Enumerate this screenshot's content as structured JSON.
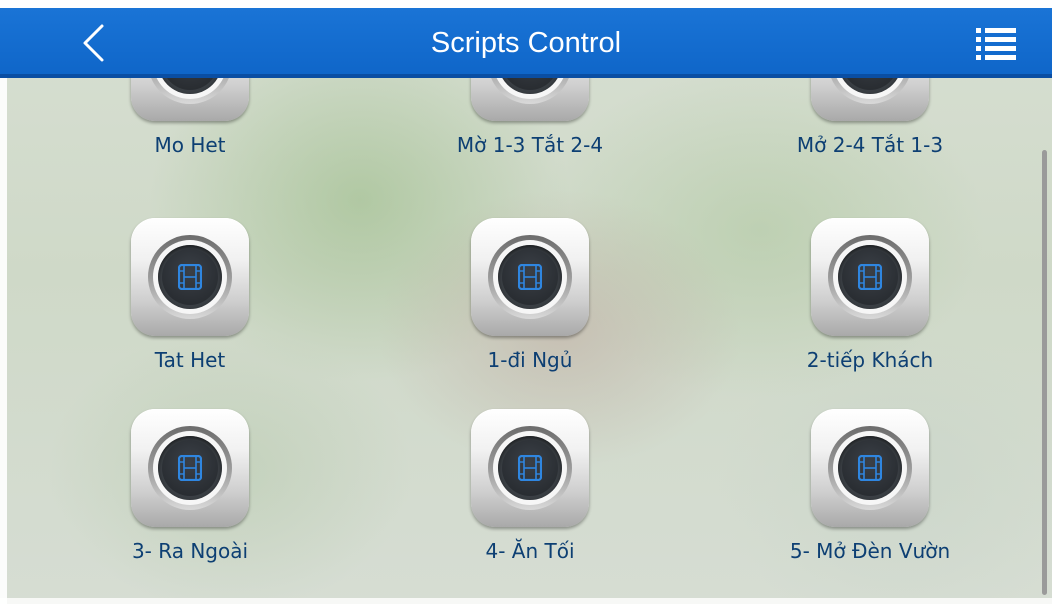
{
  "header": {
    "title": "Scripts Control",
    "back_icon": "chevron-left-icon",
    "menu_icon": "list-menu-icon"
  },
  "colors": {
    "header_bg": "#1a74d6",
    "label_text": "#0d3f73",
    "icon_accent": "#2f86e0"
  },
  "scripts": [
    {
      "label": "Mo Het",
      "icon": "film-icon"
    },
    {
      "label": "Mờ 1-3 Tắt 2-4",
      "icon": "film-icon"
    },
    {
      "label": "Mở 2-4 Tắt 1-3",
      "icon": "film-icon"
    },
    {
      "label": "Tat Het",
      "icon": "film-icon"
    },
    {
      "label": "1-đi Ngủ",
      "icon": "film-icon"
    },
    {
      "label": "2-tiếp Khách",
      "icon": "film-icon"
    },
    {
      "label": "3- Ra Ngoài",
      "icon": "film-icon"
    },
    {
      "label": "4- Ăn Tối",
      "icon": "film-icon"
    },
    {
      "label": "5- Mở Đèn Vườn",
      "icon": "film-icon"
    }
  ]
}
